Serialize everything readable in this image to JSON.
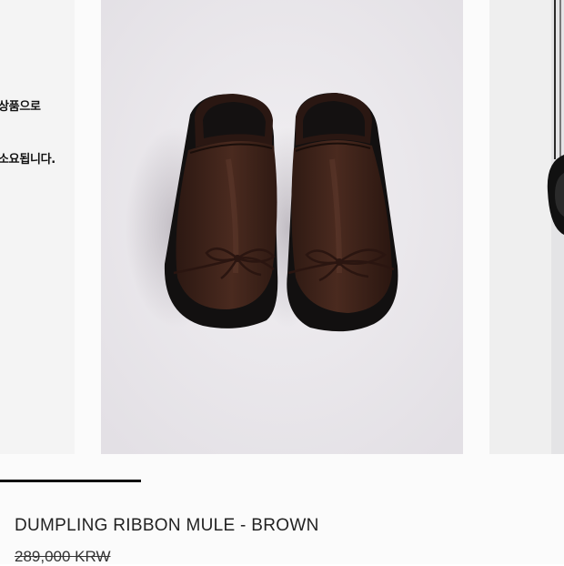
{
  "carousel": {
    "prev_slide": {
      "notice_line_1": "상품으로",
      "notice_line_2": "소요됩니다."
    },
    "current_slide": {
      "image_subject": "shoe-photo"
    },
    "next_slide": {
      "image_subject": "shoe-photo"
    },
    "progress": 0.25
  },
  "product": {
    "name": "DUMPLING RIBBON MULE - BROWN",
    "price": "289,000 KRW"
  },
  "colors": {
    "leather": "#3b2119",
    "sole": "#121010",
    "photo_bg": "#eceaee",
    "indicator": "#111111"
  }
}
